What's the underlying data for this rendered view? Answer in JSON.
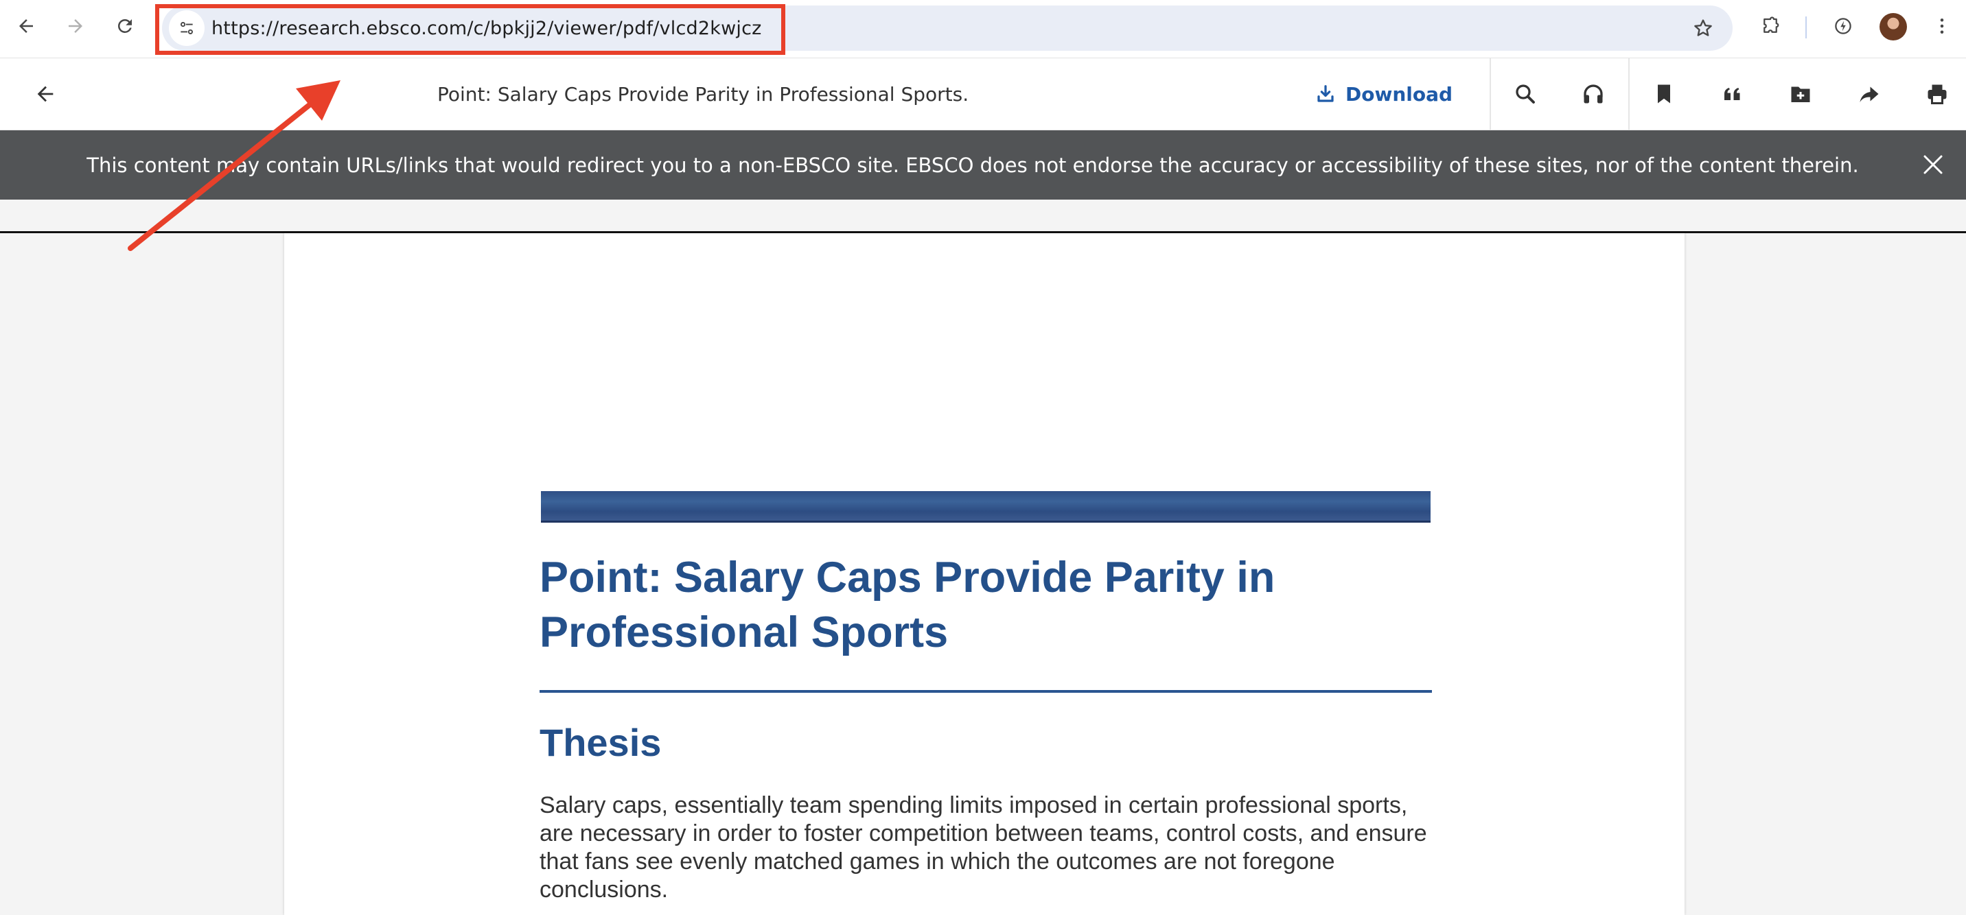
{
  "browser": {
    "url": "https://research.ebsco.com/c/bpkjj2/viewer/pdf/vlcd2kwjcz",
    "icons": [
      "back-arrow-icon",
      "forward-arrow-icon",
      "reload-icon",
      "site-settings-icon",
      "bookmark-star-icon",
      "extensions-puzzle-icon",
      "performance-icon",
      "profile-avatar",
      "more-vert-icon"
    ]
  },
  "viewer": {
    "title": "Point: Salary Caps Provide Parity in Professional Sports.",
    "download_label": "Download",
    "tools": [
      "search-icon",
      "listen-headphones-icon",
      "bookmark-icon",
      "cite-quote-icon",
      "add-to-folder-icon",
      "share-icon",
      "print-icon"
    ]
  },
  "notice": {
    "text": "This content may contain URLs/links that would redirect you to a non-EBSCO site. EBSCO does not endorse the accuracy or accessibility of these sites, nor of the content therein."
  },
  "document": {
    "title": "Point: Salary Caps Provide Parity in Professional Sports",
    "section_heading": "Thesis",
    "paragraph": "Salary caps, essentially team spending limits imposed in certain professional sports, are necessary in order to foster competition between teams, control costs, and ensure that fans see evenly matched games in which the outcomes are not foregone conclusions."
  },
  "colors": {
    "annotation": "#e8402a",
    "link_blue": "#1e5aa8",
    "heading_blue": "#24508a",
    "banner_gray": "#525456"
  }
}
